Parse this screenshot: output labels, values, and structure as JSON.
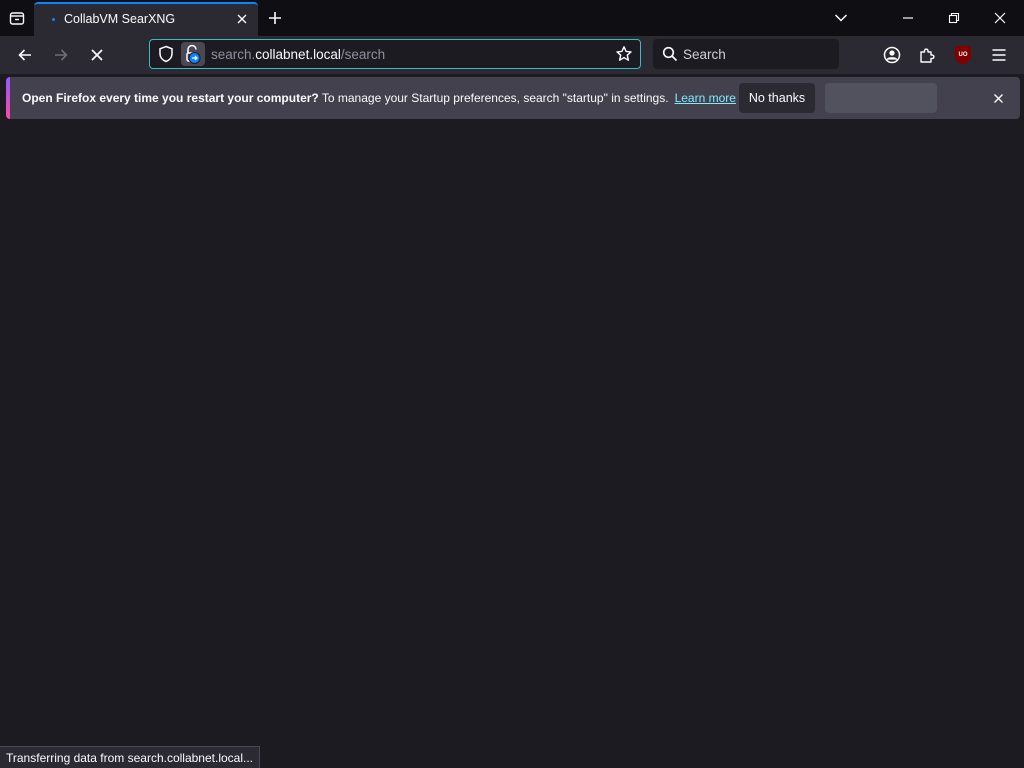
{
  "tab": {
    "title": "CollabVM SearXNG"
  },
  "navigation": {
    "url_prefix": "search.",
    "url_host": "collabnet.local",
    "url_path": "/search"
  },
  "search": {
    "placeholder": "Search"
  },
  "toolbar": {
    "ublock_badge": "UO"
  },
  "notification": {
    "bold_text": "Open Firefox every time you restart your computer?",
    "text": " To manage your Startup preferences, search \"startup\" in settings.",
    "learn_more": "Learn more",
    "no_thanks": "No thanks"
  },
  "status_bar": {
    "text": "Transferring data from search.collabnet.local..."
  },
  "colors": {
    "accent": "#0a84ff",
    "url_focus": "#3cb9c7",
    "link": "#80ebff"
  }
}
